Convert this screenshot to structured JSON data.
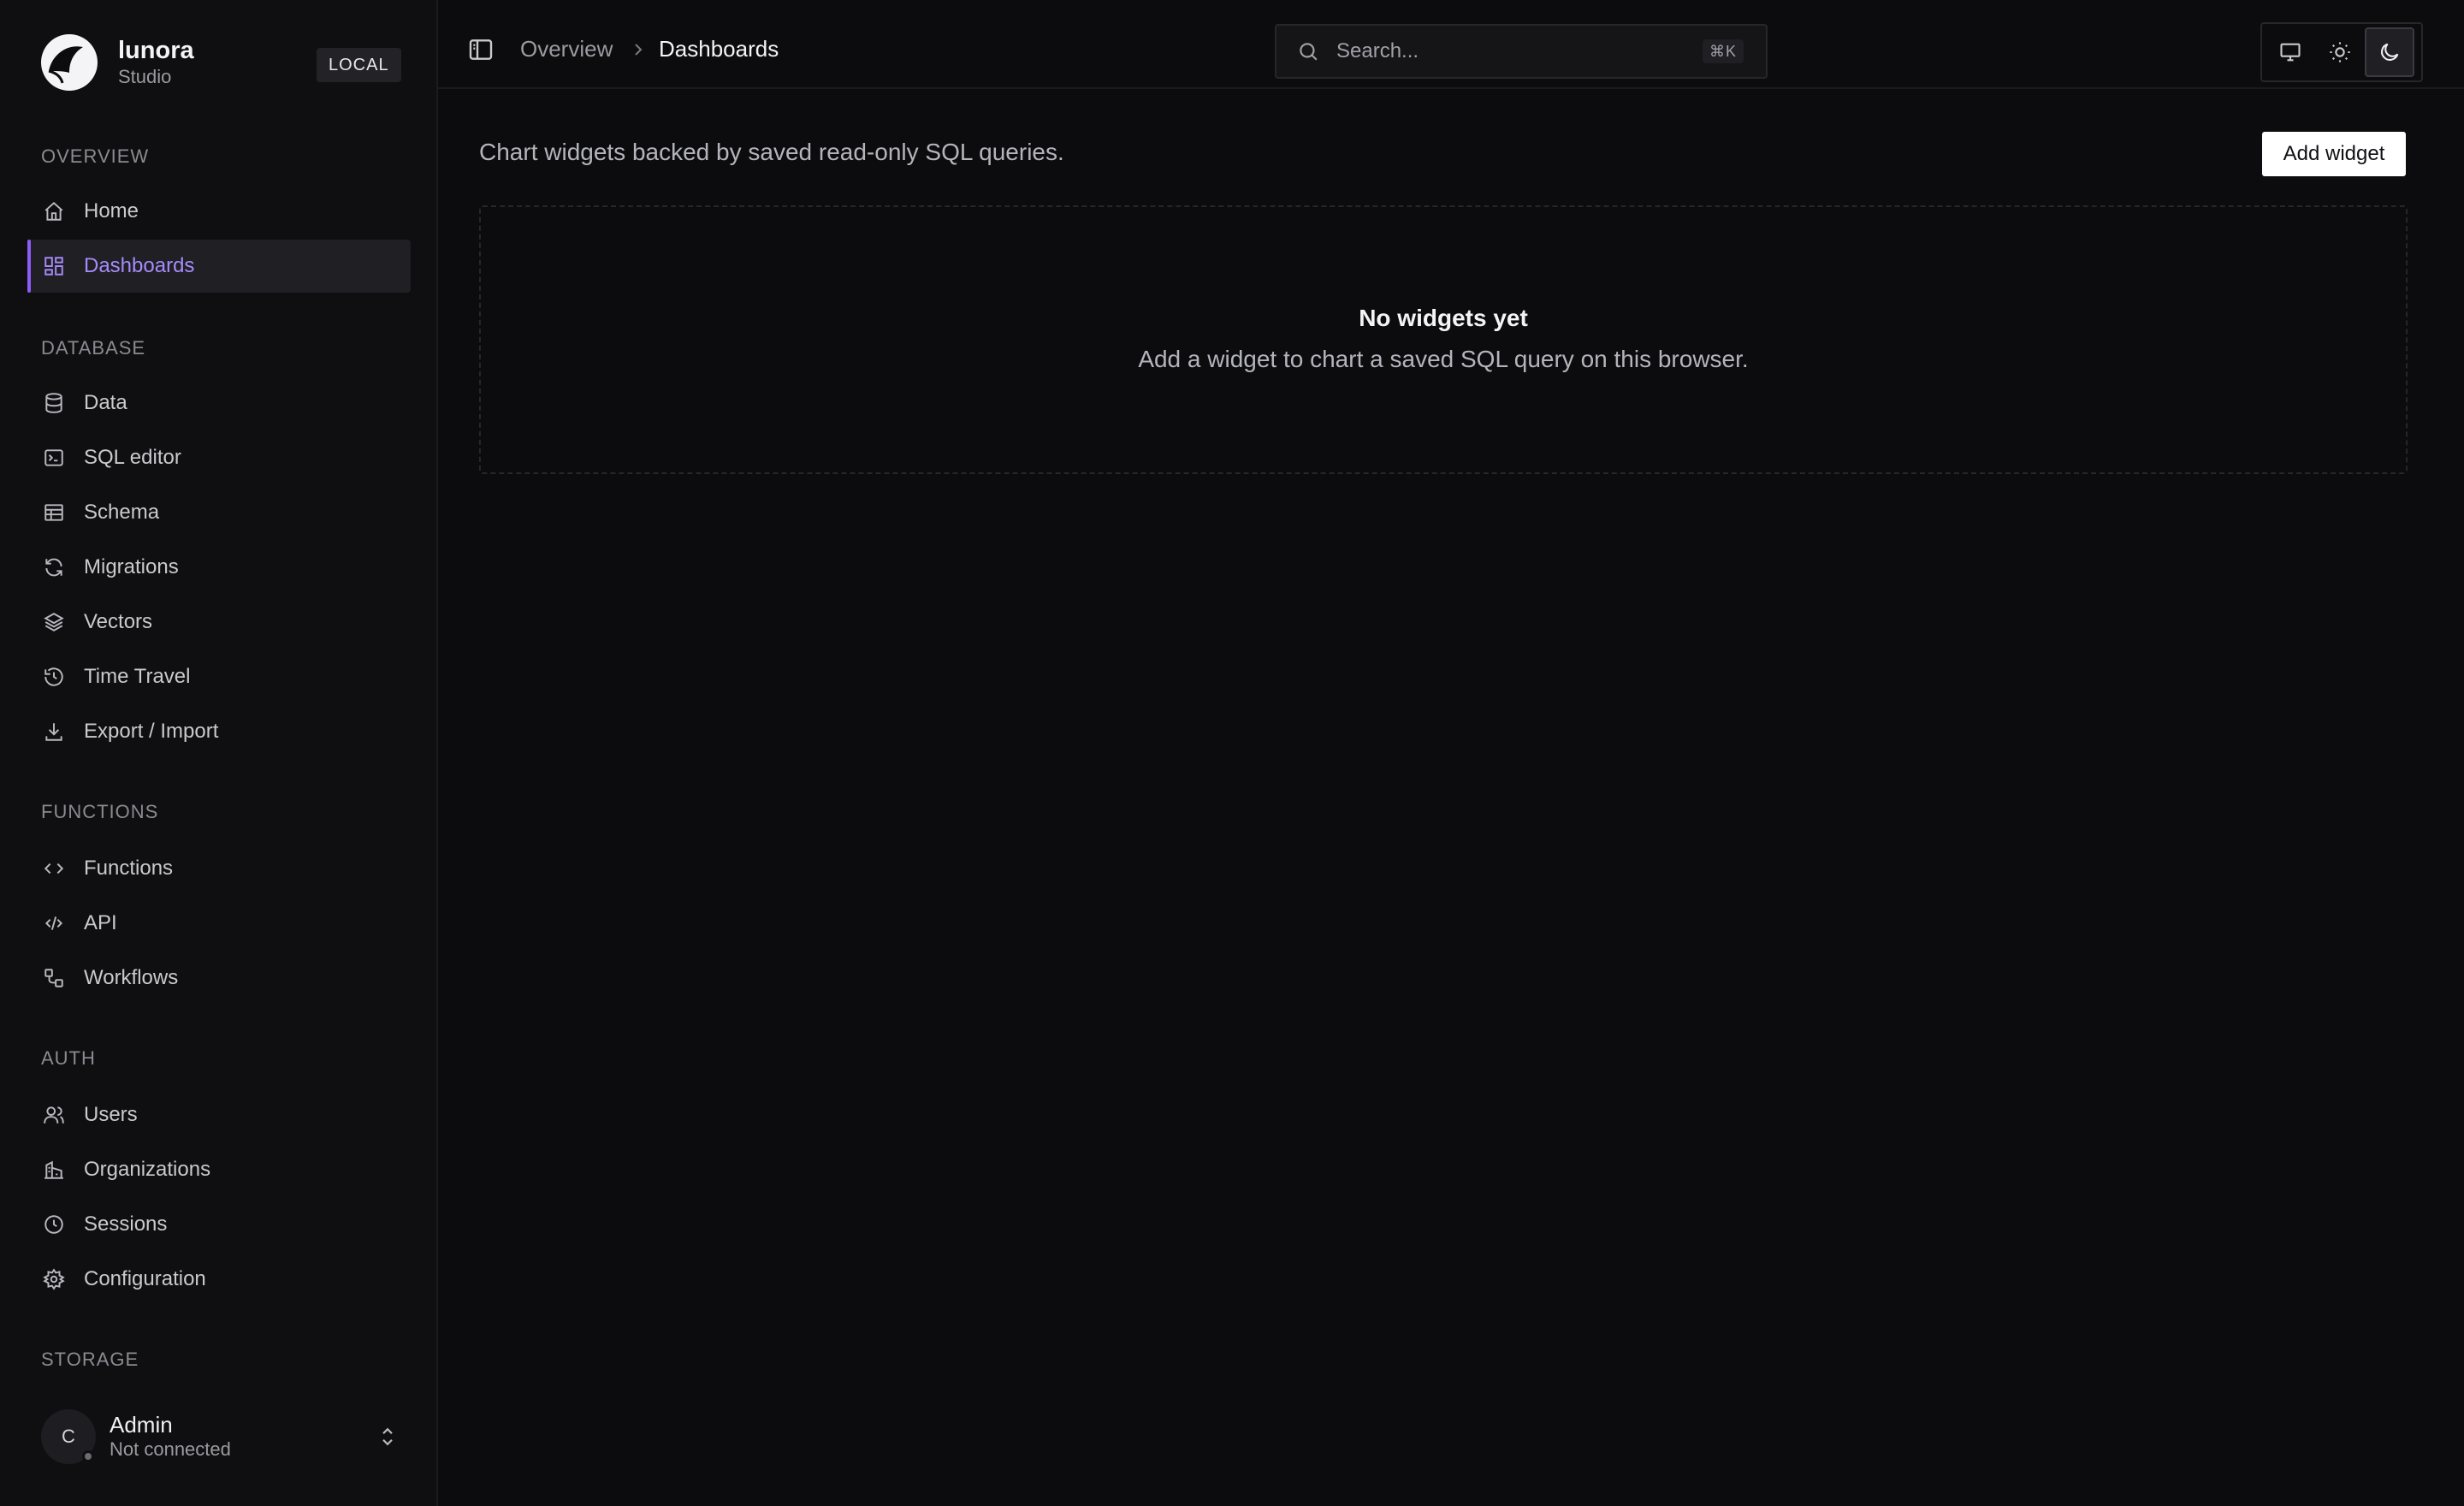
{
  "brand": {
    "name": "lunora",
    "subtitle": "Studio",
    "env_badge": "LOCAL"
  },
  "sidebar": {
    "sections": [
      {
        "title": "OVERVIEW",
        "items": [
          {
            "label": "Home",
            "icon": "home-icon"
          },
          {
            "label": "Dashboards",
            "icon": "dashboard-icon",
            "active": true
          }
        ]
      },
      {
        "title": "DATABASE",
        "items": [
          {
            "label": "Data",
            "icon": "database-icon"
          },
          {
            "label": "SQL editor",
            "icon": "terminal-icon"
          },
          {
            "label": "Schema",
            "icon": "table-icon"
          },
          {
            "label": "Migrations",
            "icon": "refresh-icon"
          },
          {
            "label": "Vectors",
            "icon": "layers-icon"
          },
          {
            "label": "Time Travel",
            "icon": "history-icon"
          },
          {
            "label": "Export / Import",
            "icon": "download-icon"
          }
        ]
      },
      {
        "title": "FUNCTIONS",
        "items": [
          {
            "label": "Functions",
            "icon": "code-icon"
          },
          {
            "label": "API",
            "icon": "code-xml-icon"
          },
          {
            "label": "Workflows",
            "icon": "workflow-icon"
          }
        ]
      },
      {
        "title": "AUTH",
        "items": [
          {
            "label": "Users",
            "icon": "users-icon"
          },
          {
            "label": "Organizations",
            "icon": "building-icon"
          },
          {
            "label": "Sessions",
            "icon": "clock-icon"
          },
          {
            "label": "Configuration",
            "icon": "gear-icon"
          }
        ]
      },
      {
        "title": "STORAGE",
        "items": []
      }
    ],
    "user": {
      "initial": "C",
      "name": "Admin",
      "status": "Not connected"
    }
  },
  "header": {
    "breadcrumb": [
      "Overview",
      "Dashboards"
    ],
    "search": {
      "placeholder": "Search...",
      "shortcut": "⌘K"
    },
    "theme_modes": [
      "system",
      "light",
      "dark"
    ],
    "theme_selected": "dark"
  },
  "main": {
    "subtitle": "Chart widgets backed by saved read-only SQL queries.",
    "add_button": "Add widget",
    "empty_title": "No widgets yet",
    "empty_desc": "Add a widget to chart a saved SQL query on this browser."
  },
  "colors": {
    "accent": "#8b5cf6",
    "accent_text": "#a78bfa",
    "background": "#0c0c0e"
  }
}
